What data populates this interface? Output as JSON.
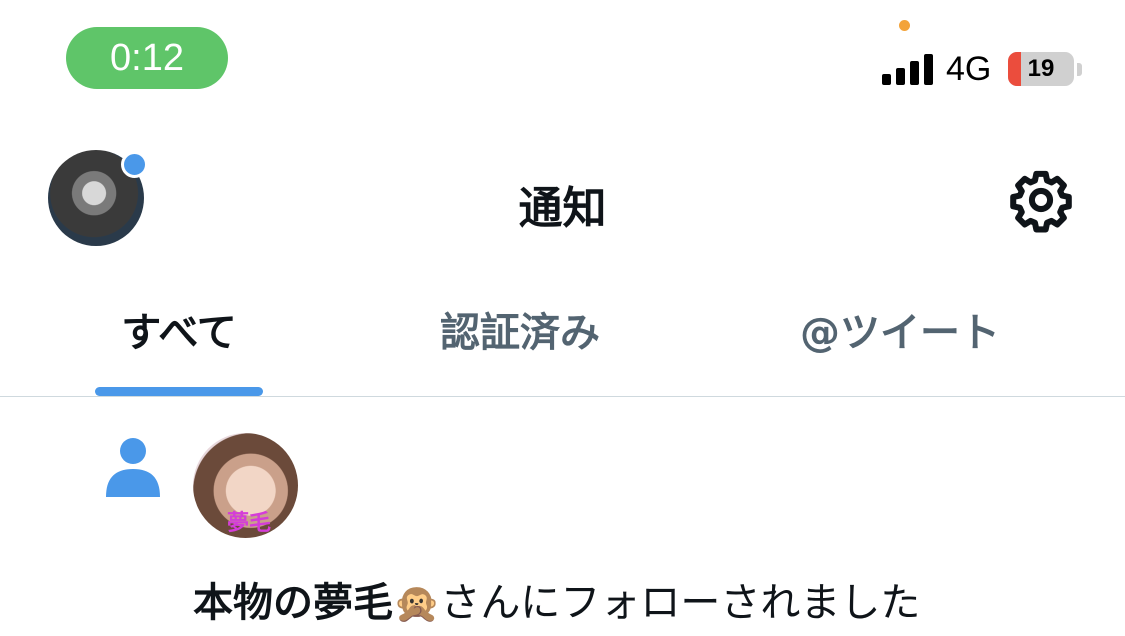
{
  "status_bar": {
    "time": "0:12",
    "network": "4G",
    "battery_level": "19",
    "signal_bars": 4,
    "colors": {
      "time_pill": "#5fc569",
      "battery_low": "#eb4d3d",
      "mic_indicator": "#f3a33a"
    }
  },
  "header": {
    "title": "通知",
    "settings_icon": "gear-icon",
    "profile_icon": "avatar"
  },
  "tabs": [
    {
      "label": "すべて",
      "selected": true
    },
    {
      "label": "認証済み",
      "selected": false
    },
    {
      "label": "@ツイート",
      "selected": false
    }
  ],
  "notification": {
    "icon": "person-icon",
    "follower_avatar_text": "夢毛",
    "user_name": "本物の夢毛",
    "emoji": "🙊",
    "message": "さんにフォローされました"
  },
  "colors": {
    "accent": "#4a98e9",
    "text": "#0f1419",
    "secondary_text": "#536471"
  }
}
